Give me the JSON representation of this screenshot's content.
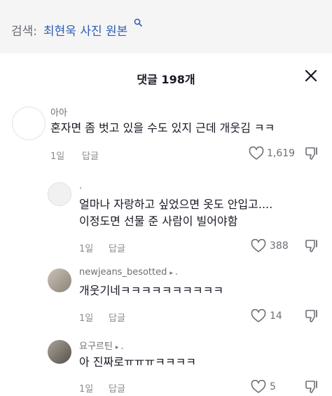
{
  "search": {
    "prefix": "검색:",
    "query": "최현욱 사진 원본"
  },
  "sheet": {
    "title": "댓글 198개"
  },
  "reply_label": "답글",
  "comments": [
    {
      "username": "아아",
      "lines": [
        "혼자면 좀 벗고 있을 수도 있지 근데 개웃김 ㅋㅋ"
      ],
      "time": "1일",
      "likes": "1,619"
    },
    {
      "username": ".",
      "lines": [
        "얼마나 자랑하고 싶었으면 옷도 안입고....",
        "이정도면 선물 준 사람이 빌어야함"
      ],
      "time": "1일",
      "likes": "388"
    },
    {
      "username": "newjeans_besotted",
      "caret": "▸",
      "after": ".",
      "lines": [
        "개웃기네ㅋㅋㅋㅋㅋㅋㅋㅋㅋㅋ"
      ],
      "time": "1일",
      "likes": "14"
    },
    {
      "username": "요구르틴",
      "caret": "▸",
      "after": ".",
      "lines": [
        "아 진짜로ㅠㅠㅠㅋㅋㅋㅋ"
      ],
      "time": "1일",
      "likes": "5"
    }
  ],
  "icons": {
    "search": "search-icon",
    "close": "close-icon",
    "like": "heart-outline-icon",
    "dislike": "thumbs-down-outline-icon"
  },
  "colors": {
    "query": "#2b5db5",
    "search_bg": "#f5f5f6",
    "muted": "#8a8b91"
  }
}
